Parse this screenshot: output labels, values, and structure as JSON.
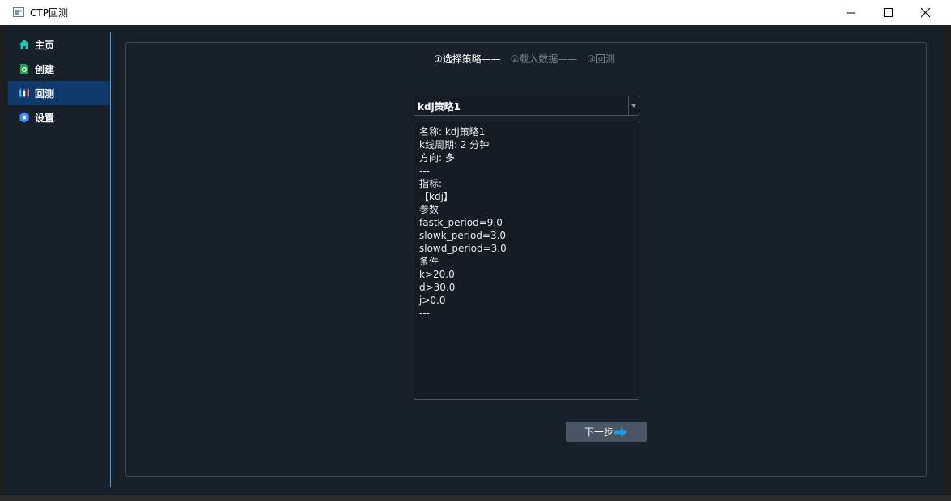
{
  "window": {
    "title": "CTP回测"
  },
  "sidebar": {
    "items": [
      {
        "label": "主页",
        "icon": "home-icon",
        "active": false
      },
      {
        "label": "创建",
        "icon": "create-icon",
        "active": false
      },
      {
        "label": "回测",
        "icon": "backtest-icon",
        "active": true
      },
      {
        "label": "设置",
        "icon": "settings-icon",
        "active": false
      }
    ]
  },
  "steps": {
    "step1": "①选择策略——",
    "step2": "②载入数据——",
    "step3": "③回测"
  },
  "strategy_select": {
    "value": "kdj策略1"
  },
  "details": {
    "lines": [
      "名称: kdj策略1",
      "k线周期: 2 分钟",
      "方向: 多",
      "---",
      "指标:",
      "【kdj】",
      "参数",
      "fastk_period=9.0",
      "slowk_period=3.0",
      "slowd_period=3.0",
      "条件",
      "k>20.0",
      "d>30.0",
      "j>0.0",
      "---"
    ]
  },
  "next_button": {
    "label": "下一步"
  },
  "colors": {
    "accent": "#3d9be9",
    "active_nav": "#0d3a6b",
    "background": "#18202a",
    "button": "#4a5665"
  }
}
